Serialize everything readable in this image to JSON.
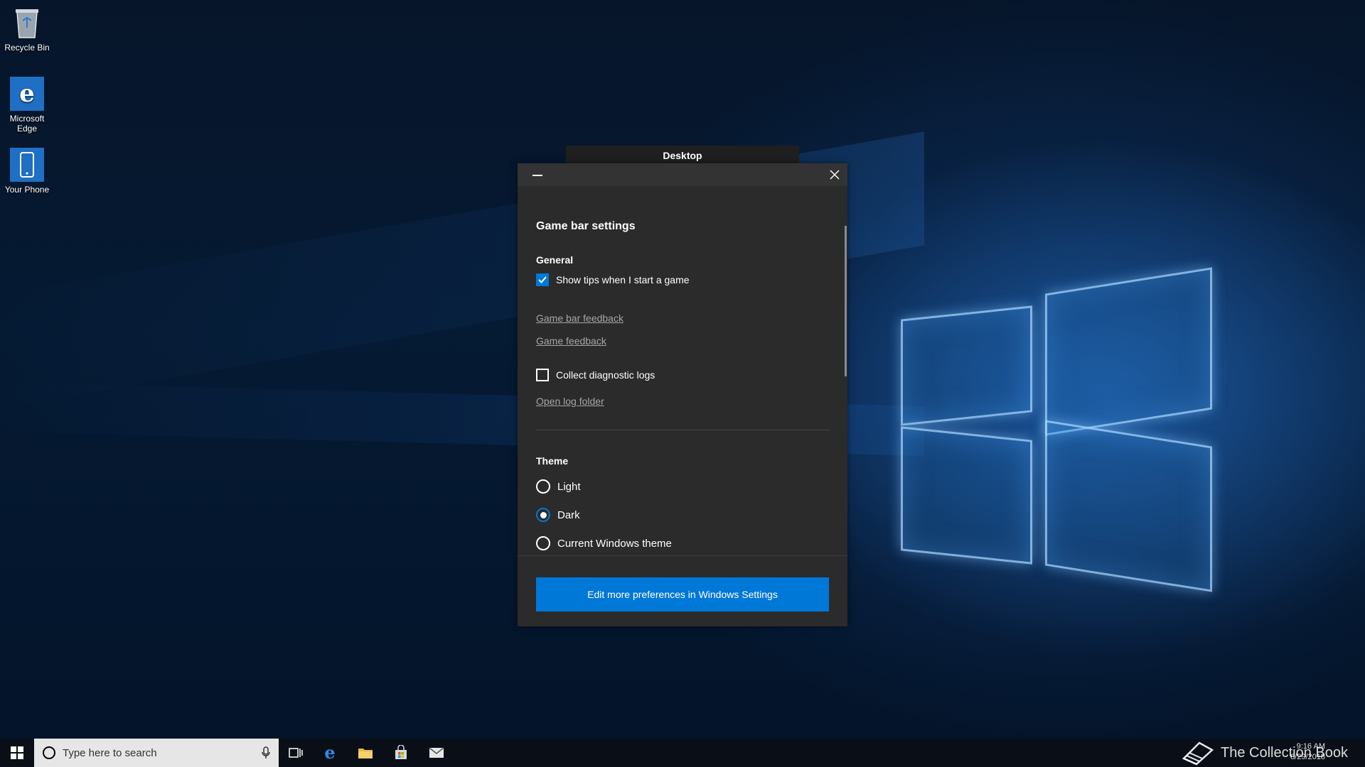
{
  "desktop_icons": [
    {
      "label": "Recycle Bin"
    },
    {
      "label": "Microsoft Edge"
    },
    {
      "label": "Your Phone"
    }
  ],
  "overlay": {
    "header": "Desktop"
  },
  "dialog": {
    "title": "Game bar settings",
    "general": {
      "heading": "General",
      "show_tips_label": "Show tips when I start a game",
      "show_tips_checked": true,
      "game_bar_feedback": "Game bar feedback",
      "game_feedback": "Game feedback",
      "collect_logs_label": "Collect diagnostic logs",
      "collect_logs_checked": false,
      "open_log_folder": "Open log folder"
    },
    "theme": {
      "heading": "Theme",
      "options": [
        {
          "label": "Light",
          "selected": false
        },
        {
          "label": "Dark",
          "selected": true
        },
        {
          "label": "Current Windows theme",
          "selected": false
        }
      ]
    },
    "footer_button": "Edit more preferences in Windows Settings"
  },
  "taskbar": {
    "search_placeholder": "Type here to search",
    "time": "9:16 AM",
    "date": "8/29/2018"
  },
  "watermark": "The Collection Book",
  "colors": {
    "accent": "#0078d7",
    "panel_bg": "#2b2b2b"
  }
}
